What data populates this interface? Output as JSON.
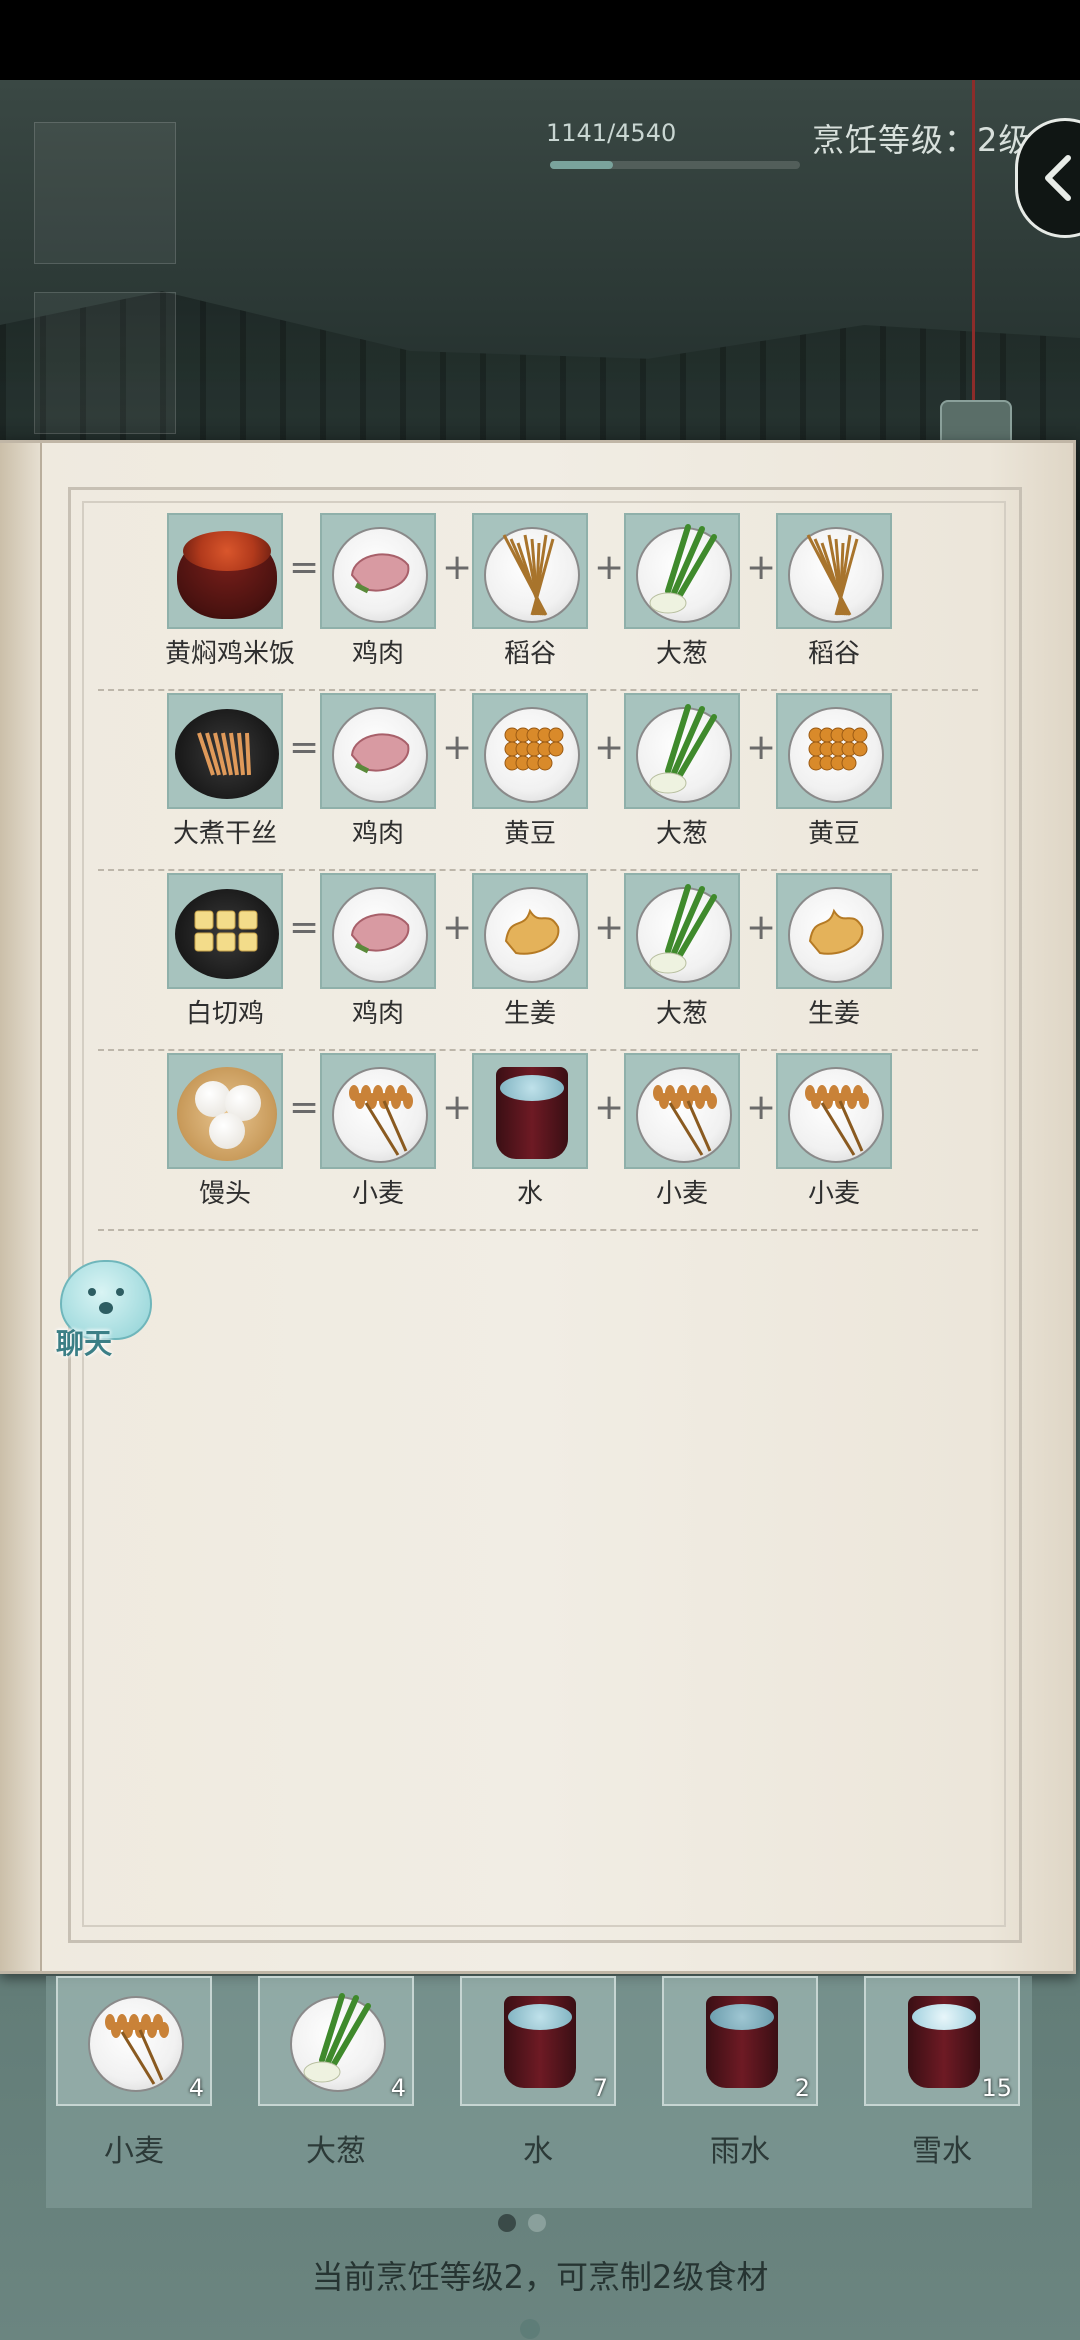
{
  "header": {
    "progress_text": "1141/4540",
    "progress_value": 0.2513,
    "cooking_level": "烹饪等级：2级"
  },
  "recipes": [
    {
      "dish": "黄焖鸡米饭",
      "ingredients": [
        "鸡肉",
        "稻谷",
        "大葱",
        "稻谷"
      ]
    },
    {
      "dish": "大煮干丝",
      "ingredients": [
        "鸡肉",
        "黄豆",
        "大葱",
        "黄豆"
      ]
    },
    {
      "dish": "白切鸡",
      "ingredients": [
        "鸡肉",
        "生姜",
        "大葱",
        "生姜"
      ]
    },
    {
      "dish": "馒头",
      "ingredients": [
        "小麦",
        "水",
        "小麦",
        "小麦"
      ]
    }
  ],
  "operators": {
    "equals": "=",
    "plus": "+"
  },
  "chat": {
    "label": "聊天"
  },
  "inventory": {
    "items": [
      {
        "name": "小麦",
        "count": "4"
      },
      {
        "name": "大葱",
        "count": "4"
      },
      {
        "name": "水",
        "count": "7"
      },
      {
        "name": "雨水",
        "count": "2"
      },
      {
        "name": "雪水",
        "count": "15"
      }
    ],
    "pages": 2,
    "active_page": 1
  },
  "footer": {
    "message": "当前烹饪等级2，可烹制2级食材"
  },
  "colors": {
    "tile": "#a7c3be",
    "paper": "#f1ede4",
    "accent": "#5e7d78"
  },
  "icons": {
    "back": "chevron-left-icon",
    "chat": "chat-bubble-icon"
  }
}
